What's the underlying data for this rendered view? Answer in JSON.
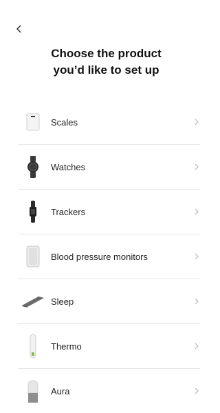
{
  "nav": {
    "back_icon": "chevron-left-icon"
  },
  "header": {
    "title_line1": "Choose the product",
    "title_line2": "you’d like to set up"
  },
  "products": [
    {
      "label": "Scales",
      "icon": "scale-icon"
    },
    {
      "label": "Watches",
      "icon": "watch-icon"
    },
    {
      "label": "Trackers",
      "icon": "tracker-icon"
    },
    {
      "label": "Blood pressure monitors",
      "icon": "blood-pressure-monitor-icon"
    },
    {
      "label": "Sleep",
      "icon": "sleep-sensor-icon"
    },
    {
      "label": "Thermo",
      "icon": "thermometer-icon"
    },
    {
      "label": "Aura",
      "icon": "aura-lamp-icon"
    }
  ],
  "colors": {
    "text": "#111111",
    "divider": "#e6e6e6",
    "chevron": "#b5b5b5"
  }
}
